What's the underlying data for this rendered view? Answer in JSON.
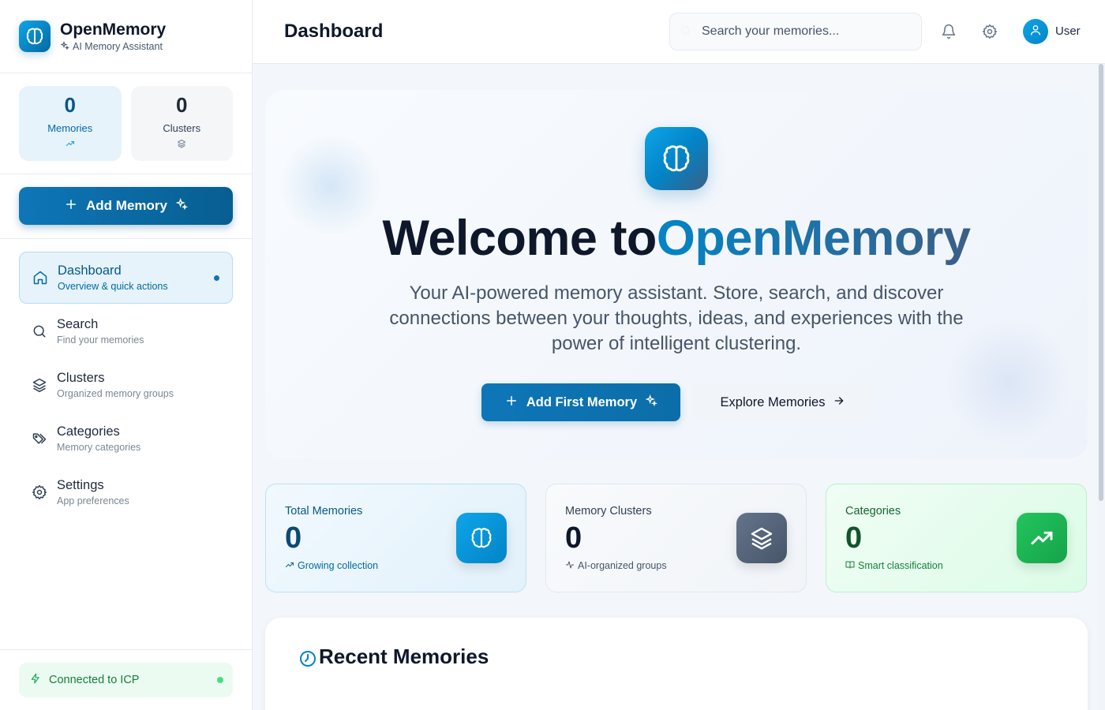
{
  "brand": {
    "title": "OpenMemory",
    "subtitle": "AI Memory Assistant"
  },
  "stats": [
    {
      "value": "0",
      "label": "Memories"
    },
    {
      "value": "0",
      "label": "Clusters"
    }
  ],
  "sidebar": {
    "add_button": "Add Memory",
    "items": [
      {
        "title": "Dashboard",
        "desc": "Overview & quick actions",
        "icon": "home-icon",
        "active": true
      },
      {
        "title": "Search",
        "desc": "Find your memories",
        "icon": "search-icon"
      },
      {
        "title": "Clusters",
        "desc": "Organized memory groups",
        "icon": "layers-icon"
      },
      {
        "title": "Categories",
        "desc": "Memory categories",
        "icon": "tags-icon"
      },
      {
        "title": "Settings",
        "desc": "App preferences",
        "icon": "gear-icon"
      }
    ],
    "status": "Connected to ICP"
  },
  "header": {
    "title": "Dashboard",
    "search_placeholder": "Search your memories...",
    "user": "User"
  },
  "hero": {
    "title_prefix": "Welcome to",
    "title_accent": "OpenMemory",
    "description": "Your AI-powered memory assistant. Store, search, and discover connections between your thoughts, ideas, and experiences with the power of intelligent clustering.",
    "primary_button": "Add First Memory",
    "secondary_button": "Explore Memories"
  },
  "cards": [
    {
      "title": "Total Memories",
      "value": "0",
      "note": "Growing collection",
      "icon": "brain-icon"
    },
    {
      "title": "Memory Clusters",
      "value": "0",
      "note": "AI-organized groups",
      "icon": "layers-icon"
    },
    {
      "title": "Categories",
      "value": "0",
      "note": "Smart classification",
      "icon": "trending-up-icon"
    }
  ],
  "recent": {
    "title": "Recent Memories"
  },
  "colors": {
    "accent": "#0e76b8",
    "success": "#16a34a",
    "neutral": "#475569"
  }
}
